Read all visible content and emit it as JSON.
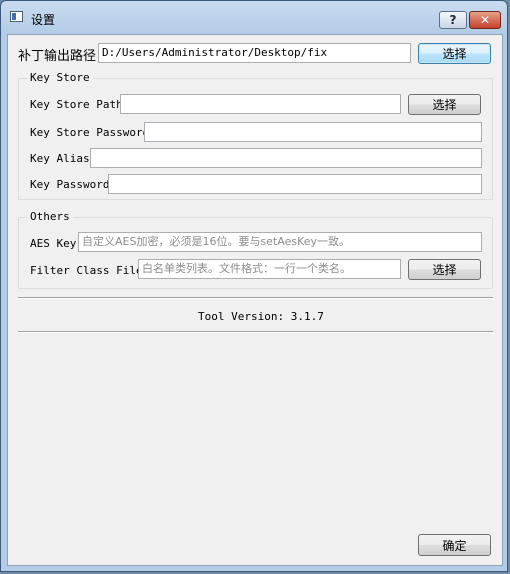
{
  "window": {
    "title": "设置",
    "help_glyph": "?",
    "close_glyph": "✕"
  },
  "patch": {
    "label": "补丁输出路径",
    "value": "D:/Users/Administrator/Desktop/fix",
    "button": "选择"
  },
  "key_store": {
    "group_title": "Key Store",
    "path_label": "Key Store Path",
    "path_value": "",
    "path_button": "选择",
    "password_label": "Key Store Password",
    "password_value": "",
    "alias_label": "Key Alias",
    "alias_value": "",
    "key_password_label": "Key Password",
    "key_password_value": ""
  },
  "others": {
    "group_title": "Others",
    "aes_label": "AES Key",
    "aes_placeholder": "自定义AES加密，必须是16位。要与setAesKey一致。",
    "filter_label": "Filter Class File",
    "filter_placeholder": "白名单类列表。文件格式：一行一个类名。",
    "filter_button": "选择"
  },
  "version": "Tool Version: 3.1.7",
  "footer": {
    "ok_button": "确定"
  }
}
